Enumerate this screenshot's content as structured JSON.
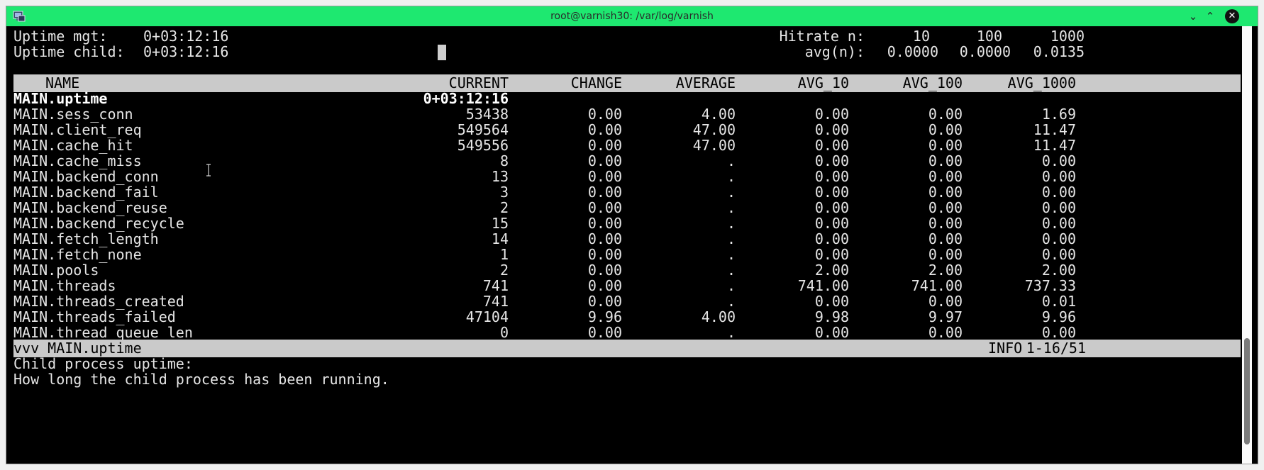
{
  "window": {
    "title": "root@varnish30: /var/log/varnish",
    "minimize": "⌄",
    "maximize": "⌃",
    "close": "✕"
  },
  "top": {
    "uptime_mgt_label": "Uptime mgt:",
    "uptime_mgt_value": "0+03:12:16",
    "uptime_child_label": "Uptime child:",
    "uptime_child_value": "0+03:12:16",
    "hitrate_label": "Hitrate n:",
    "hitrate_n": [
      "10",
      "100",
      "1000"
    ],
    "avg_label": "avg(n):",
    "avg_values": [
      "0.0000",
      "0.0000",
      "0.0135"
    ]
  },
  "columns": [
    "NAME",
    "CURRENT",
    "CHANGE",
    "AVERAGE",
    "AVG_10",
    "AVG_100",
    "AVG_1000"
  ],
  "rows": [
    [
      "MAIN.uptime",
      "0+03:12:16",
      "",
      "",
      "",
      "",
      ""
    ],
    [
      "MAIN.sess_conn",
      "53438",
      "0.00",
      "4.00",
      "0.00",
      "0.00",
      "1.69"
    ],
    [
      "MAIN.client_req",
      "549564",
      "0.00",
      "47.00",
      "0.00",
      "0.00",
      "11.47"
    ],
    [
      "MAIN.cache_hit",
      "549556",
      "0.00",
      "47.00",
      "0.00",
      "0.00",
      "11.47"
    ],
    [
      "MAIN.cache_miss",
      "8",
      "0.00",
      ".",
      "0.00",
      "0.00",
      "0.00"
    ],
    [
      "MAIN.backend_conn",
      "13",
      "0.00",
      ".",
      "0.00",
      "0.00",
      "0.00"
    ],
    [
      "MAIN.backend_fail",
      "3",
      "0.00",
      ".",
      "0.00",
      "0.00",
      "0.00"
    ],
    [
      "MAIN.backend_reuse",
      "2",
      "0.00",
      ".",
      "0.00",
      "0.00",
      "0.00"
    ],
    [
      "MAIN.backend_recycle",
      "15",
      "0.00",
      ".",
      "0.00",
      "0.00",
      "0.00"
    ],
    [
      "MAIN.fetch_length",
      "14",
      "0.00",
      ".",
      "0.00",
      "0.00",
      "0.00"
    ],
    [
      "MAIN.fetch_none",
      "1",
      "0.00",
      ".",
      "0.00",
      "0.00",
      "0.00"
    ],
    [
      "MAIN.pools",
      "2",
      "0.00",
      ".",
      "2.00",
      "2.00",
      "2.00"
    ],
    [
      "MAIN.threads",
      "741",
      "0.00",
      ".",
      "741.00",
      "741.00",
      "737.33"
    ],
    [
      "MAIN.threads_created",
      "741",
      "0.00",
      ".",
      "0.00",
      "0.00",
      "0.01"
    ],
    [
      "MAIN.threads_failed",
      "47104",
      "9.96",
      "4.00",
      "9.98",
      "9.97",
      "9.96"
    ],
    [
      "MAIN.thread_queue_len",
      "0",
      "0.00",
      ".",
      "0.00",
      "0.00",
      "0.00"
    ]
  ],
  "status": {
    "left": "vvv MAIN.uptime",
    "info": "INFO",
    "range": "1-16/51"
  },
  "description": {
    "title": "Child process uptime:",
    "text": "How long the child process has been running."
  }
}
